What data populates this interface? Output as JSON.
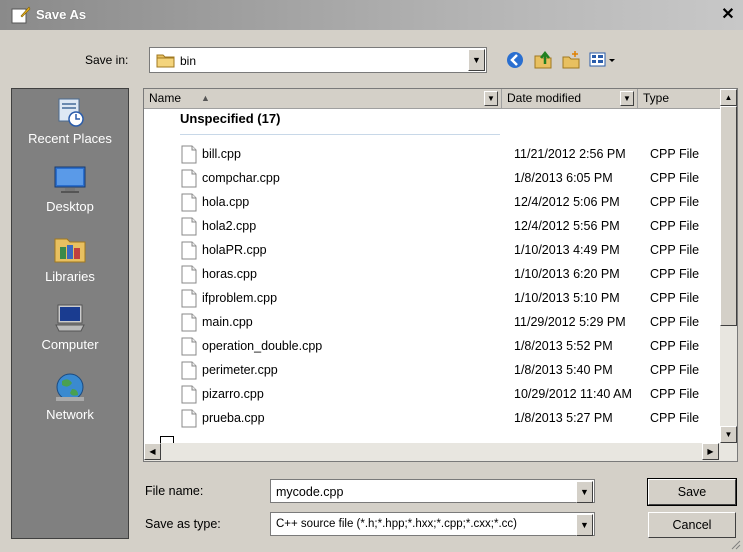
{
  "window": {
    "title": "Save As"
  },
  "save_in": {
    "label": "Save in:",
    "value": "bin"
  },
  "places": [
    {
      "label": "Recent Places",
      "icon": "recent-places-icon"
    },
    {
      "label": "Desktop",
      "icon": "desktop-icon"
    },
    {
      "label": "Libraries",
      "icon": "libraries-icon"
    },
    {
      "label": "Computer",
      "icon": "computer-icon"
    },
    {
      "label": "Network",
      "icon": "network-icon"
    }
  ],
  "columns": {
    "name": "Name",
    "date": "Date modified",
    "type": "Type"
  },
  "group": {
    "label": "Unspecified (17)"
  },
  "files": [
    {
      "name": "bill.cpp",
      "date": "11/21/2012 2:56 PM",
      "type": "CPP File"
    },
    {
      "name": "compchar.cpp",
      "date": "1/8/2013 6:05 PM",
      "type": "CPP File"
    },
    {
      "name": "hola.cpp",
      "date": "12/4/2012 5:06 PM",
      "type": "CPP File"
    },
    {
      "name": "hola2.cpp",
      "date": "12/4/2012 5:56 PM",
      "type": "CPP File"
    },
    {
      "name": "holaPR.cpp",
      "date": "1/10/2013 4:49 PM",
      "type": "CPP File"
    },
    {
      "name": "horas.cpp",
      "date": "1/10/2013 6:20 PM",
      "type": "CPP File"
    },
    {
      "name": "ifproblem.cpp",
      "date": "1/10/2013 5:10 PM",
      "type": "CPP File"
    },
    {
      "name": "main.cpp",
      "date": "11/29/2012 5:29 PM",
      "type": "CPP File"
    },
    {
      "name": "operation_double.cpp",
      "date": "1/8/2013 5:52 PM",
      "type": "CPP File"
    },
    {
      "name": "perimeter.cpp",
      "date": "1/8/2013 5:40 PM",
      "type": "CPP File"
    },
    {
      "name": "pizarro.cpp",
      "date": "10/29/2012 11:40 AM",
      "type": "CPP File"
    },
    {
      "name": "prueba.cpp",
      "date": "1/8/2013 5:27 PM",
      "type": "CPP File"
    }
  ],
  "file_name": {
    "label": "File name:",
    "value": "mycode.cpp"
  },
  "save_as_type": {
    "label": "Save as type:",
    "value": "C++ source file (*.h;*.hpp;*.hxx;*.cpp;*.cxx;*.cc)"
  },
  "buttons": {
    "save": "Save",
    "cancel": "Cancel"
  }
}
